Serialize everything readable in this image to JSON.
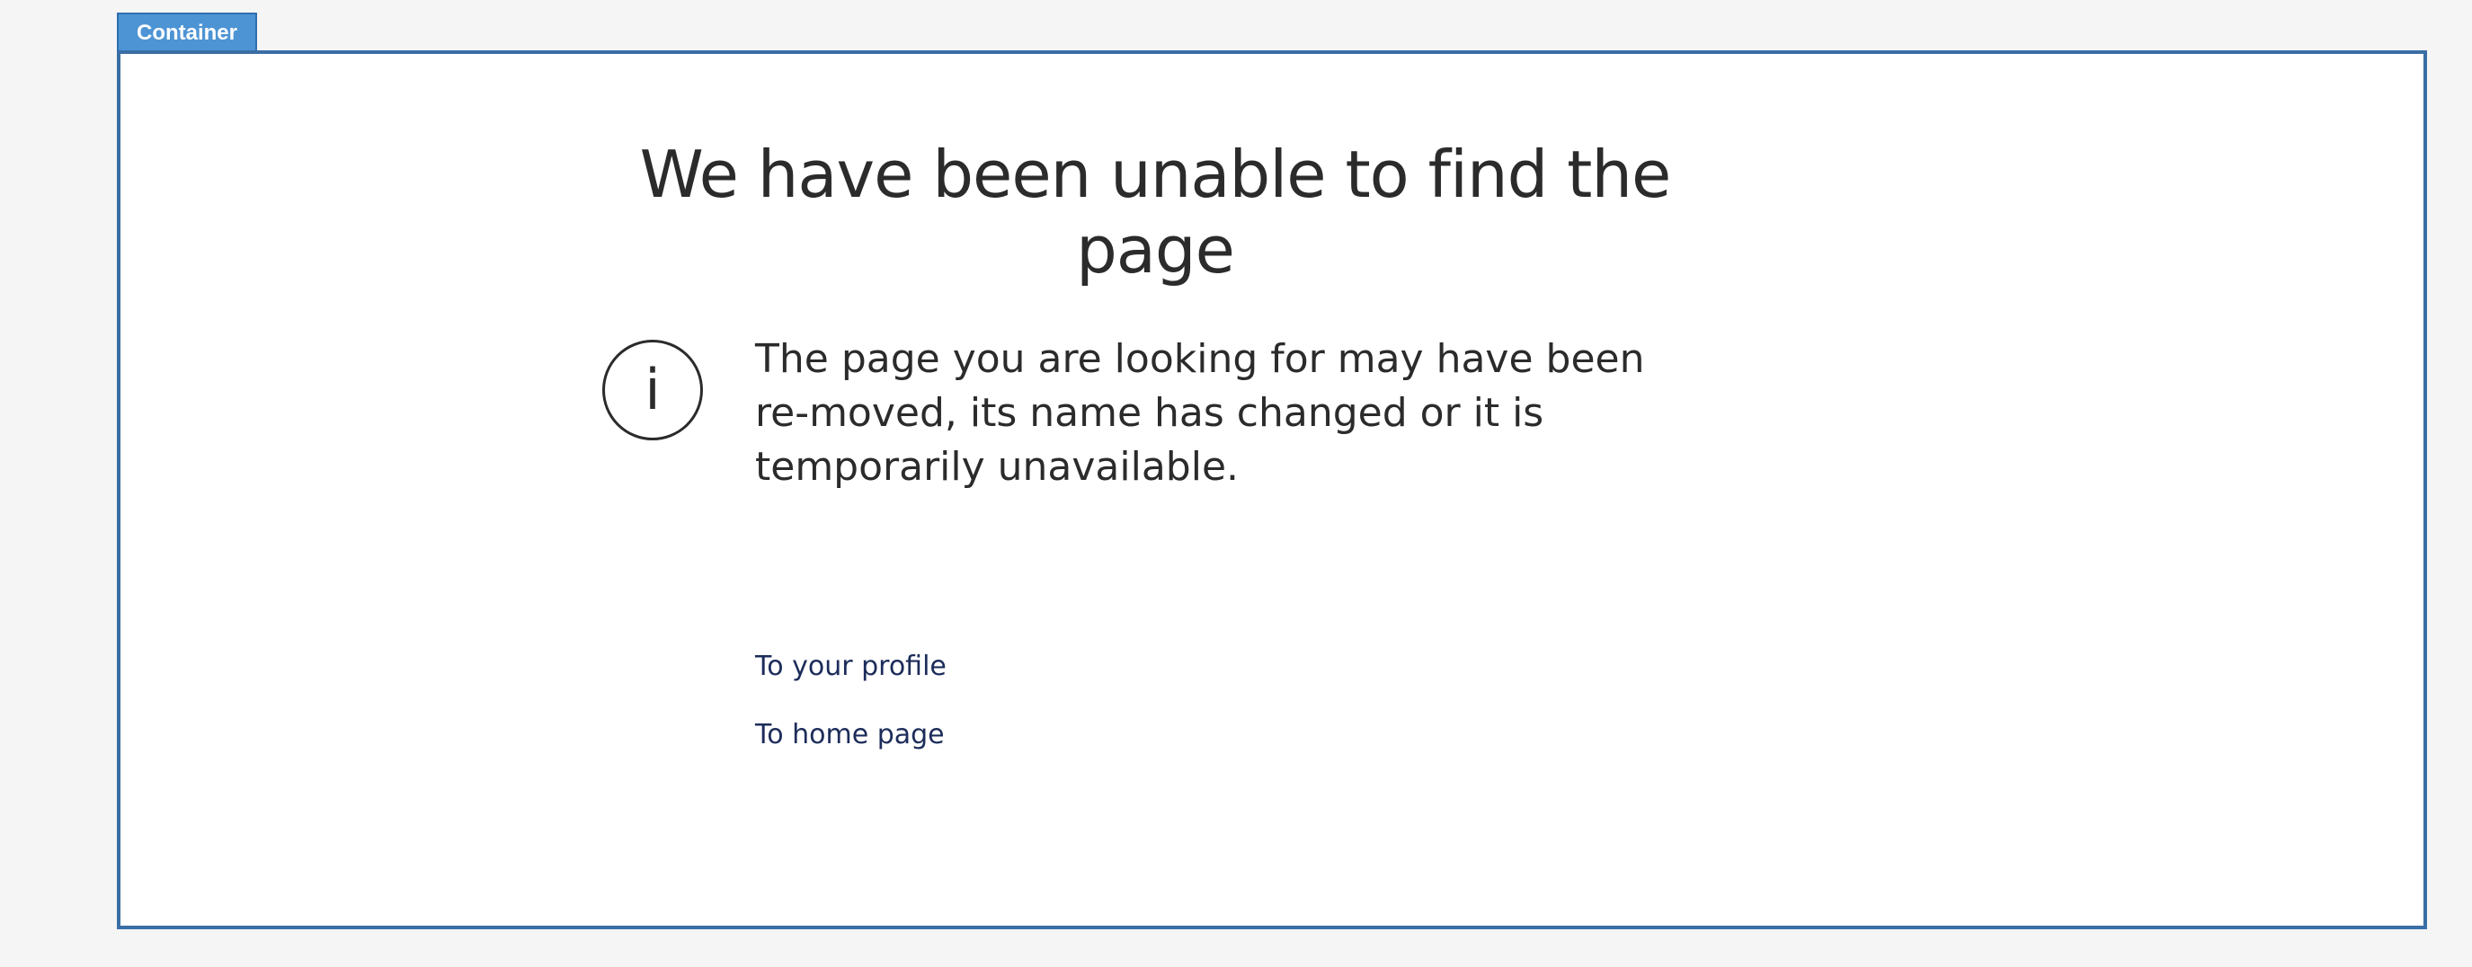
{
  "container": {
    "tab_label": "Container"
  },
  "error_page": {
    "title": "We have been unable to find the page",
    "info_icon_glyph": "i",
    "icon": "info-icon",
    "message": "The page you are looking for may have been re-moved, its name has changed or it is temporarily unavailable.",
    "links": [
      {
        "label": "To your profile"
      },
      {
        "label": "To home page"
      }
    ]
  },
  "colors": {
    "tab_background": "#4d94d4",
    "frame_border": "#3a6ea5",
    "text": "#2b2b2b",
    "link": "#1c2c5a"
  }
}
